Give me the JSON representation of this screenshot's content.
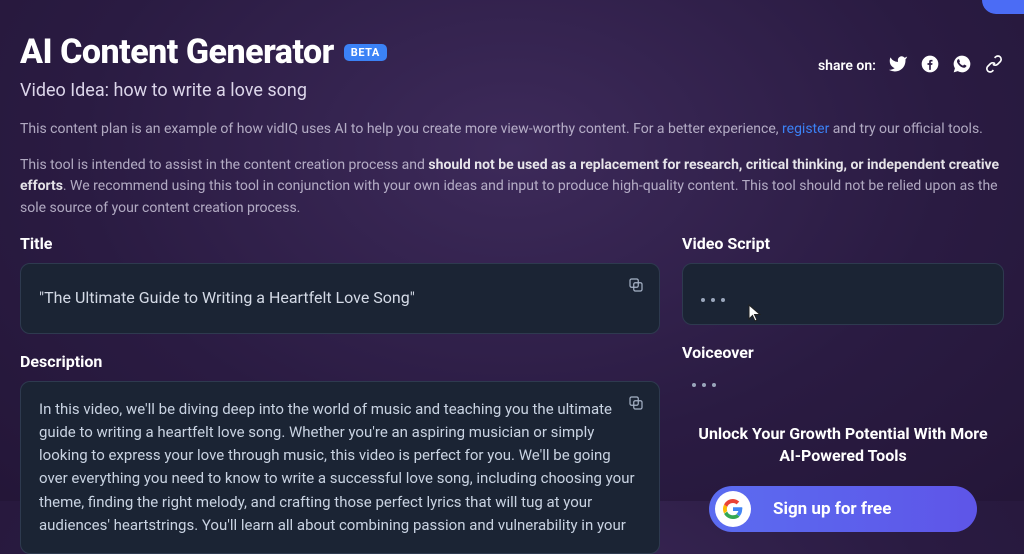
{
  "header": {
    "title": "AI Content Generator",
    "badge": "BETA",
    "video_idea": "Video Idea: how to write a love song",
    "share_label": "share on:"
  },
  "intro": {
    "line1_a": "This content plan is an example of how vidIQ uses AI to help you create more view-worthy content. For a better experience, ",
    "register": "register",
    "line1_b": " and try our official tools.",
    "line2_a": "This tool is intended to assist in the content creation process and ",
    "line2_strong": "should not be used as a replacement for research, critical thinking, or independent creative efforts",
    "line2_b": ". We recommend using this tool in conjunction with your own ideas and input to produce high-quality content. This tool should not be relied upon as the sole source of your content creation process."
  },
  "left": {
    "title_label": "Title",
    "title_value": "\"The Ultimate Guide to Writing a Heartfelt Love Song\"",
    "description_label": "Description",
    "description_value": "In this video, we'll be diving deep into the world of music and teaching you the ultimate guide to writing a heartfelt love song. Whether you're an aspiring musician or simply looking to express your love through music, this video is perfect for you. We'll be going over everything you need to know to write a successful love song, including choosing your theme, finding the right melody, and crafting those perfect lyrics that will tug at your audiences' heartstrings. You'll learn all about combining passion and vulnerability in your"
  },
  "right": {
    "script_label": "Video Script",
    "voiceover_label": "Voiceover",
    "growth_text": "Unlock Your Growth Potential With More AI-Powered Tools",
    "signup_label": "Sign up for free"
  }
}
